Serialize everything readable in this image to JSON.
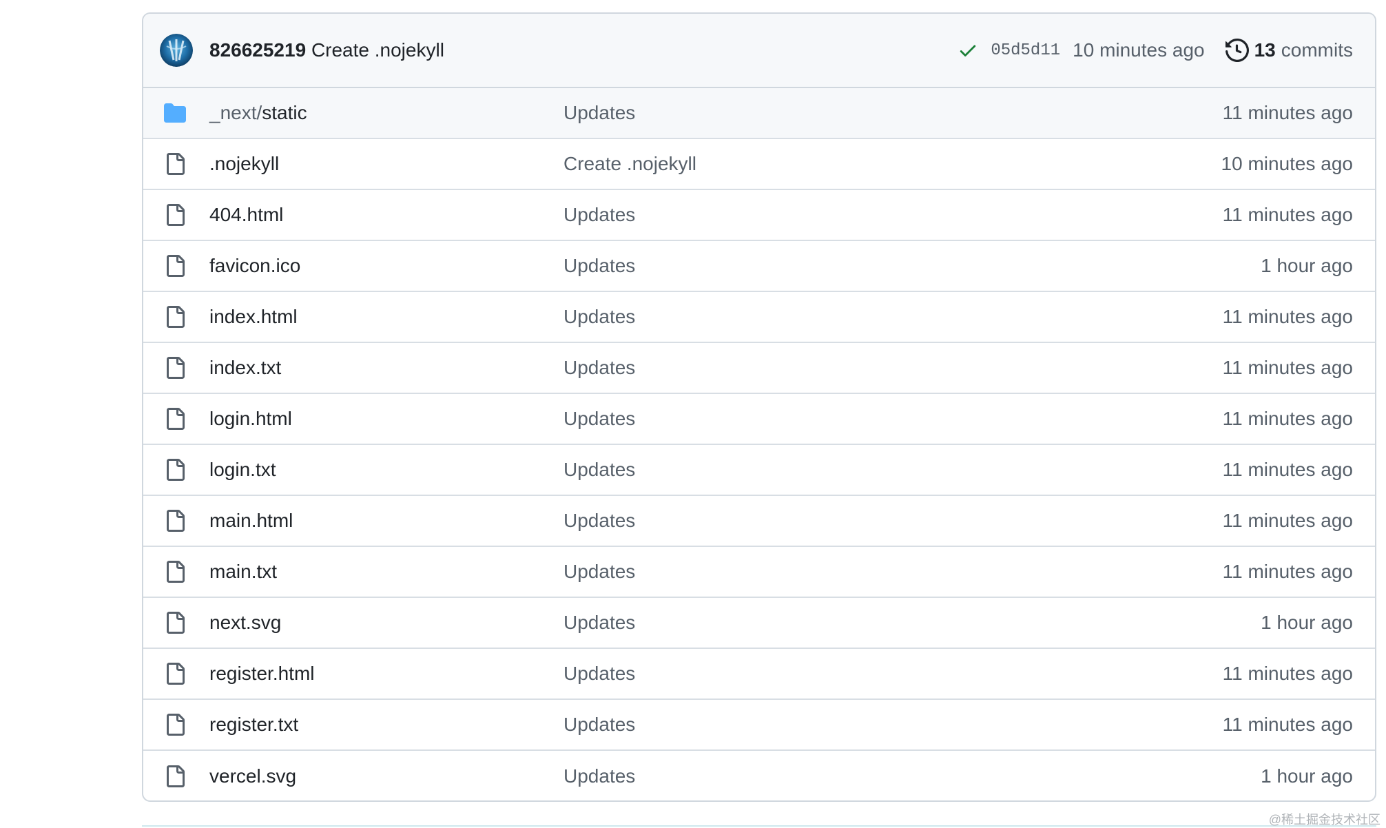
{
  "commit": {
    "author": "826625219",
    "message": "Create .nojekyll",
    "sha": "05d5d11",
    "time": "10 minutes ago",
    "commits_count": "13",
    "commits_label": "commits"
  },
  "files": [
    {
      "type": "folder",
      "name_prefix": "_next/",
      "name": "static",
      "message": "Updates",
      "age": "11 minutes ago",
      "icon": "folder-icon"
    },
    {
      "type": "file",
      "name_prefix": "",
      "name": ".nojekyll",
      "message": "Create .nojekyll",
      "age": "10 minutes ago",
      "icon": "file-icon"
    },
    {
      "type": "file",
      "name_prefix": "",
      "name": "404.html",
      "message": "Updates",
      "age": "11 minutes ago",
      "icon": "file-icon"
    },
    {
      "type": "file",
      "name_prefix": "",
      "name": "favicon.ico",
      "message": "Updates",
      "age": "1 hour ago",
      "icon": "file-icon"
    },
    {
      "type": "file",
      "name_prefix": "",
      "name": "index.html",
      "message": "Updates",
      "age": "11 minutes ago",
      "icon": "file-icon"
    },
    {
      "type": "file",
      "name_prefix": "",
      "name": "index.txt",
      "message": "Updates",
      "age": "11 minutes ago",
      "icon": "file-icon"
    },
    {
      "type": "file",
      "name_prefix": "",
      "name": "login.html",
      "message": "Updates",
      "age": "11 minutes ago",
      "icon": "file-icon"
    },
    {
      "type": "file",
      "name_prefix": "",
      "name": "login.txt",
      "message": "Updates",
      "age": "11 minutes ago",
      "icon": "file-icon"
    },
    {
      "type": "file",
      "name_prefix": "",
      "name": "main.html",
      "message": "Updates",
      "age": "11 minutes ago",
      "icon": "file-icon"
    },
    {
      "type": "file",
      "name_prefix": "",
      "name": "main.txt",
      "message": "Updates",
      "age": "11 minutes ago",
      "icon": "file-icon"
    },
    {
      "type": "file",
      "name_prefix": "",
      "name": "next.svg",
      "message": "Updates",
      "age": "1 hour ago",
      "icon": "file-icon"
    },
    {
      "type": "file",
      "name_prefix": "",
      "name": "register.html",
      "message": "Updates",
      "age": "11 minutes ago",
      "icon": "file-icon"
    },
    {
      "type": "file",
      "name_prefix": "",
      "name": "register.txt",
      "message": "Updates",
      "age": "11 minutes ago",
      "icon": "file-icon"
    },
    {
      "type": "file",
      "name_prefix": "",
      "name": "vercel.svg",
      "message": "Updates",
      "age": "1 hour ago",
      "icon": "file-icon"
    }
  ],
  "watermark": "@稀土掘金技术社区",
  "colors": {
    "check": "#1a7f37",
    "folder": "#54aeff",
    "border": "#d0d7de",
    "muted_text": "#57606a"
  }
}
